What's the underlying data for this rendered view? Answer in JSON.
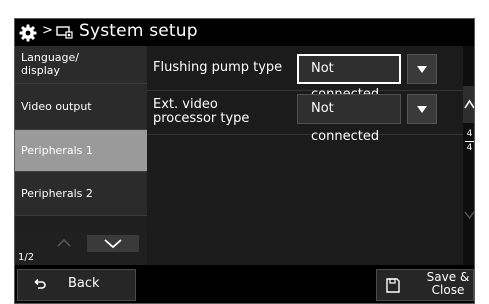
{
  "header": {
    "separator": ">",
    "title": "System setup"
  },
  "nav": {
    "items": [
      {
        "label_line1": "Language/",
        "label_line2": "display"
      },
      {
        "label_line1": "Video output",
        "label_line2": ""
      },
      {
        "label_line1": "Peripherals 1",
        "label_line2": ""
      },
      {
        "label_line1": "Peripherals 2",
        "label_line2": ""
      }
    ],
    "page_indicator": "1/2"
  },
  "settings": [
    {
      "label_line1": "Flushing pump type",
      "label_line2": "",
      "value": "Not connected"
    },
    {
      "label_line1": "Ext. video",
      "label_line2": "processor type",
      "value": "Not connected"
    }
  ],
  "scroller": {
    "page_current": "4",
    "page_total": "4"
  },
  "footer": {
    "back_label": "Back",
    "save_label_line1": "Save &",
    "save_label_line2": "Close"
  },
  "colors": {
    "active_nav": "#9a9a9a",
    "background": "#181818",
    "focus_border": "#ffffff"
  },
  "icons": [
    "gear-icon",
    "system-icon",
    "chevron-up-icon",
    "chevron-down-icon",
    "dropdown-arrow-icon",
    "back-arrow-icon",
    "save-icon"
  ]
}
